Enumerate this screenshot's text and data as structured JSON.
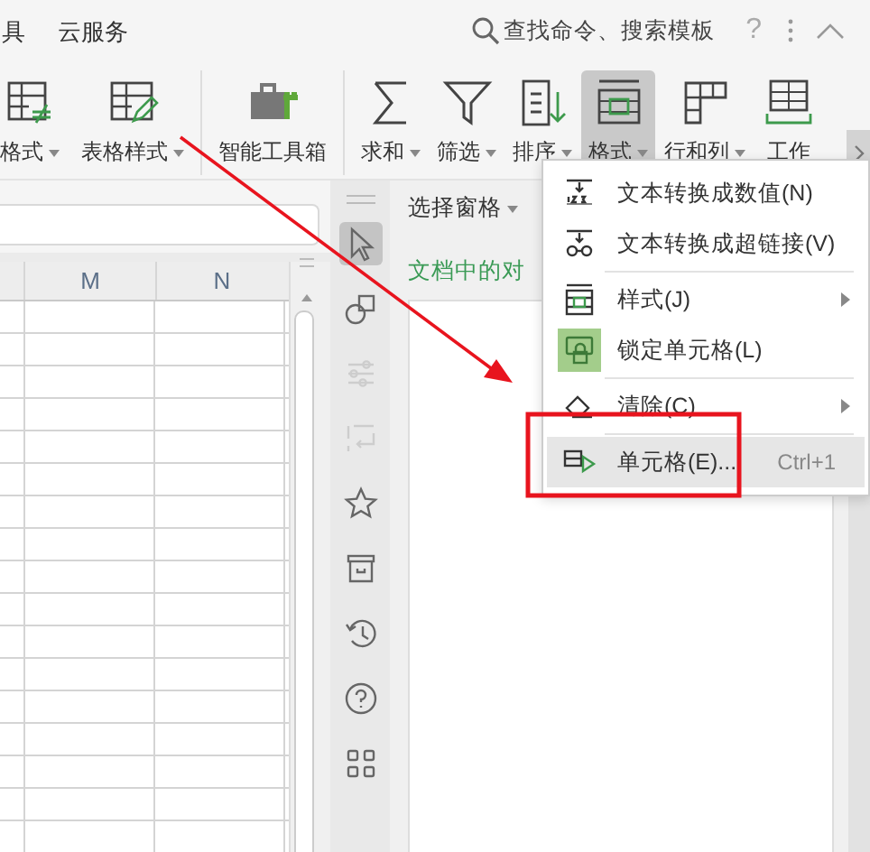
{
  "menu_bar": {
    "tabs": [
      {
        "label": "具"
      },
      {
        "label": "云服务"
      }
    ],
    "search": {
      "placeholder": "查找命令、搜索模板"
    },
    "help": "?"
  },
  "ribbon": {
    "items": [
      {
        "kind": "conditional",
        "label": "格式",
        "dropdown": true,
        "selected": false
      },
      {
        "kind": "table-style",
        "label": "表格样式",
        "dropdown": true,
        "selected": false
      },
      {
        "kind": "toolbox",
        "label": "智能工具箱",
        "dropdown": false,
        "selected": false
      },
      {
        "kind": "sum",
        "label": "求和",
        "dropdown": true,
        "selected": false
      },
      {
        "kind": "filter",
        "label": "筛选",
        "dropdown": true,
        "selected": false
      },
      {
        "kind": "sort",
        "label": "排序",
        "dropdown": true,
        "selected": false
      },
      {
        "kind": "format",
        "label": "格式",
        "dropdown": true,
        "selected": true
      },
      {
        "kind": "rowcol",
        "label": "行和列",
        "dropdown": true,
        "selected": false
      },
      {
        "kind": "sheet",
        "label": "工作",
        "dropdown": false,
        "selected": false
      }
    ]
  },
  "sheet": {
    "columns": [
      "M",
      "N"
    ]
  },
  "sidebar": {
    "tools": [
      {
        "kind": "select",
        "selected": true,
        "disabled": false
      },
      {
        "kind": "shapes",
        "selected": false,
        "disabled": false
      },
      {
        "kind": "sliders",
        "selected": false,
        "disabled": true
      },
      {
        "kind": "swap",
        "selected": false,
        "disabled": true
      },
      {
        "kind": "star",
        "selected": false,
        "disabled": false
      },
      {
        "kind": "archive",
        "selected": false,
        "disabled": false
      },
      {
        "kind": "history",
        "selected": false,
        "disabled": false
      },
      {
        "kind": "help",
        "selected": false,
        "disabled": false
      },
      {
        "kind": "apps",
        "selected": false,
        "disabled": false
      }
    ]
  },
  "task_pane": {
    "title": "选择窗格",
    "subtitle": "文档中的对"
  },
  "format_menu": {
    "items": [
      {
        "kind": "to-number",
        "label": "文本转换成数值(N)",
        "submenu": false,
        "checked": false,
        "selected": false,
        "separator_after": false
      },
      {
        "kind": "to-link",
        "label": "文本转换成超链接(V)",
        "submenu": false,
        "checked": false,
        "selected": false,
        "separator_after": true
      },
      {
        "kind": "style",
        "label": "样式(J)",
        "submenu": true,
        "checked": false,
        "selected": false,
        "separator_after": false
      },
      {
        "kind": "lock",
        "label": "锁定单元格(L)",
        "submenu": false,
        "checked": true,
        "selected": false,
        "separator_after": true
      },
      {
        "kind": "clear",
        "label": "清除(C)",
        "submenu": true,
        "checked": false,
        "selected": false,
        "separator_after": true
      },
      {
        "kind": "cell",
        "label": "单元格(E)...",
        "shortcut": "Ctrl+1",
        "submenu": false,
        "checked": false,
        "selected": true,
        "separator_after": false
      }
    ]
  }
}
